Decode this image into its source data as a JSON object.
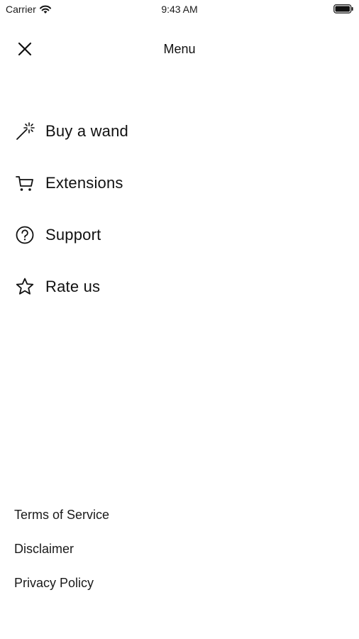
{
  "status_bar": {
    "carrier": "Carrier",
    "time": "9:43 AM"
  },
  "header": {
    "title": "Menu",
    "close_icon": "close-icon"
  },
  "menu": {
    "items": [
      {
        "label": "Buy a wand",
        "icon": "magic-wand-icon"
      },
      {
        "label": "Extensions",
        "icon": "shopping-cart-icon"
      },
      {
        "label": "Support",
        "icon": "question-circle-icon"
      },
      {
        "label": "Rate us",
        "icon": "star-icon"
      }
    ]
  },
  "footer": {
    "links": [
      {
        "label": "Terms of Service"
      },
      {
        "label": "Disclaimer"
      },
      {
        "label": "Privacy Policy"
      }
    ]
  },
  "colors": {
    "background": "#ffffff",
    "text": "#111111"
  }
}
